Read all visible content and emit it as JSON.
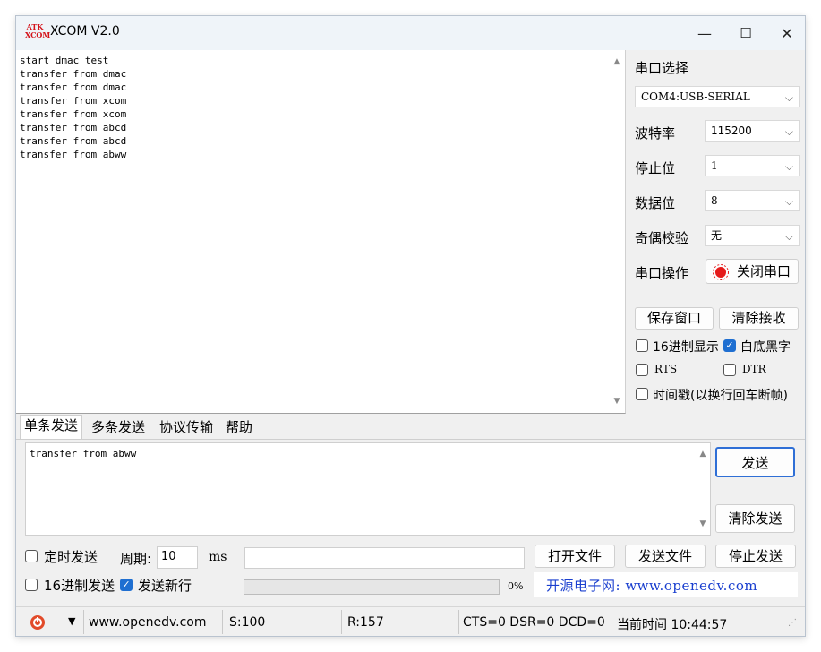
{
  "window": {
    "app_logo_text": "ATK XCOM",
    "title": "XCOM V2.0",
    "min_glyph": "—",
    "max_glyph": "☐",
    "close_glyph": "✕"
  },
  "receive": {
    "lines": "start dmac test\ntransfer from dmac\ntransfer from dmac\ntransfer from xcom\ntransfer from xcom\ntransfer from abcd\ntransfer from abcd\ntransfer from abww"
  },
  "side": {
    "port_select_label": "串口选择",
    "port_value": "COM4:USB-SERIAL",
    "baud_label": "波特率",
    "baud_value": "115200",
    "stop_label": "停止位",
    "stop_value": "1",
    "data_label": "数据位",
    "data_value": "8",
    "parity_label": "奇偶校验",
    "parity_value": "无",
    "port_op_label": "串口操作",
    "close_port_label": "关闭串口",
    "save_window_label": "保存窗口",
    "clear_receive_label": "清除接收",
    "hex_display_label": "16进制显示",
    "white_black_label": "白底黑字",
    "rts_label": "RTS",
    "dtr_label": "DTR",
    "timestamp_label": "时间戳(以换行回车断帧)",
    "hex_display_checked": false,
    "white_black_checked": true,
    "rts_checked": false,
    "dtr_checked": false,
    "timestamp_checked": false
  },
  "tabs": {
    "single_send": "单条发送",
    "multi_send": "多条发送",
    "protocol": "协议传输",
    "help": "帮助"
  },
  "send": {
    "text": "transfer from abww",
    "send_button": "发送",
    "clear_send_button": "清除发送",
    "timed_send_label": "定时发送",
    "period_label": "周期:",
    "period_value": "10",
    "ms_label": "ms",
    "open_file_button": "打开文件",
    "send_file_button": "发送文件",
    "stop_send_button": "停止发送",
    "hex_send_label": "16进制发送",
    "send_newline_label": "发送新行",
    "timed_send_checked": false,
    "hex_send_checked": false,
    "send_newline_checked": true,
    "progress_percent_label": "0%",
    "progress_fraction": 0,
    "site_banner": "开源电子网: www.openedv.com"
  },
  "status": {
    "website": "www.openedv.com",
    "sent": "S:100",
    "received": "R:157",
    "signals": "CTS=0 DSR=0 DCD=0",
    "time": "当前时间 10:44:57"
  },
  "colors": {
    "accent": "#1f6fd1",
    "banner_blue": "#1a3fcf",
    "logo_red": "#d4131b"
  }
}
